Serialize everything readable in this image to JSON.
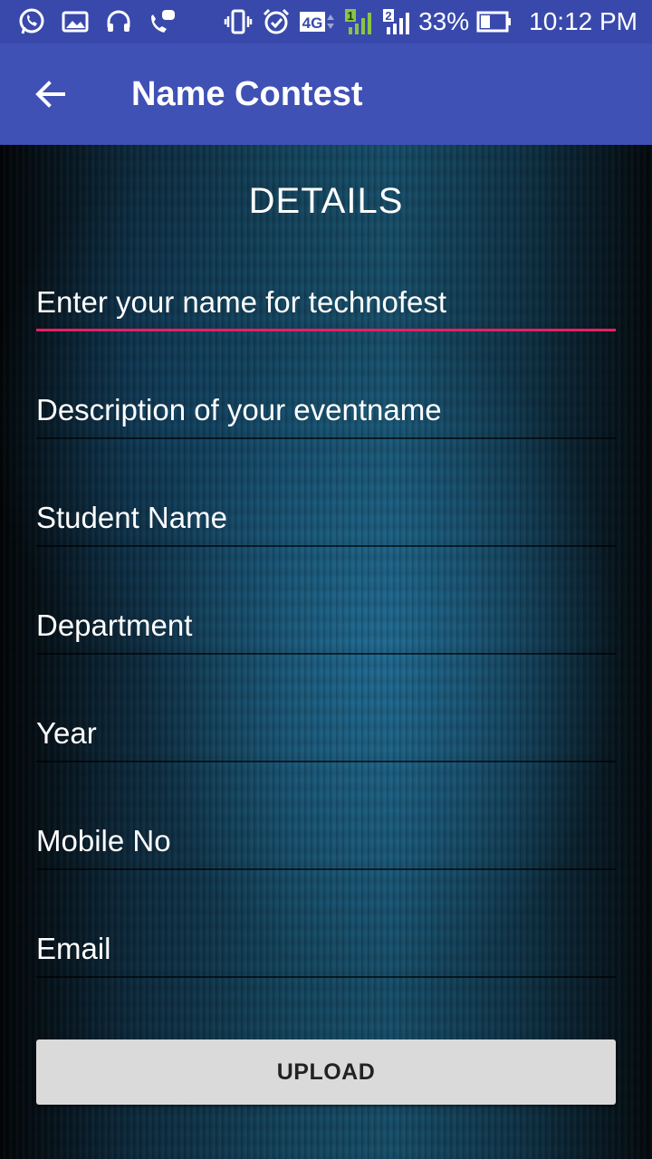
{
  "status_bar": {
    "icons": [
      "whatsapp-icon",
      "image-icon",
      "headset-icon",
      "call-message-icon",
      "vibrate-icon",
      "alarm-icon",
      "4g-icon",
      "signal-sim1-icon",
      "signal-sim2-icon",
      "battery-icon"
    ],
    "network_label": "4G",
    "sim1_label": "1",
    "sim2_label": "2",
    "battery": "33%",
    "time": "10:12 PM"
  },
  "app_bar": {
    "title": "Name Contest",
    "back_icon": "arrow-back-icon"
  },
  "form": {
    "heading": "DETAILS",
    "fields": [
      {
        "placeholder": "Enter your name for technofest",
        "value": "",
        "focused": true
      },
      {
        "placeholder": "Description of your eventname",
        "value": ""
      },
      {
        "placeholder": "Student Name",
        "value": ""
      },
      {
        "placeholder": "Department",
        "value": ""
      },
      {
        "placeholder": "Year",
        "value": ""
      },
      {
        "placeholder": "Mobile No",
        "value": ""
      },
      {
        "placeholder": "Email",
        "value": ""
      }
    ],
    "upload_label": "UPLOAD"
  },
  "colors": {
    "status_bar": "#3949ab",
    "app_bar": "#3f51b5",
    "focus_underline": "#e91e63",
    "button": "#dadada"
  }
}
